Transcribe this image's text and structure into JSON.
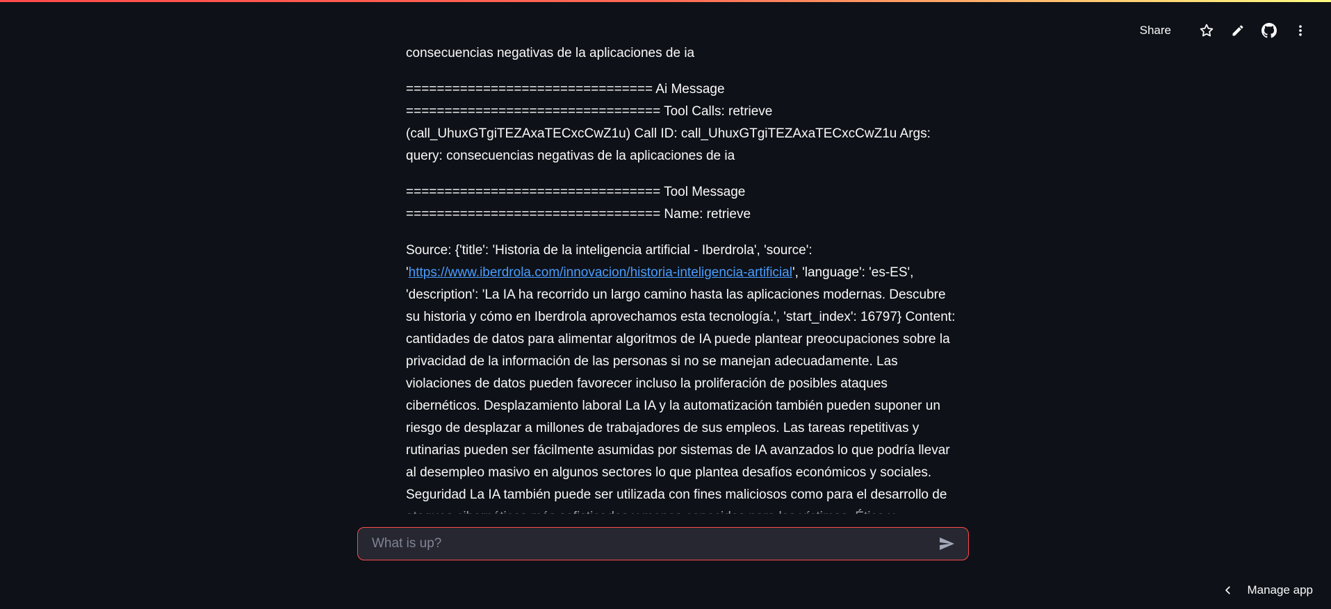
{
  "header": {
    "share_label": "Share",
    "icons": [
      "star-icon",
      "pencil-icon",
      "github-icon",
      "more-vert-icon"
    ]
  },
  "messages": {
    "line_top": "consecuencias negativas de la aplicaciones de ia",
    "ai_message": "================================ Ai Message ================================= Tool Calls: retrieve (call_UhuxGTgiTEZAxaTECxcCwZ1u) Call ID: call_UhuxGTgiTEZAxaTECxcCwZ1u Args: query: consecuencias negativas de la aplicaciones de ia",
    "tool_message": "================================= Tool Message ================================= Name: retrieve",
    "source_before_link": "Source: {'title': 'Historia de la inteligencia artificial - Iberdrola', 'source': '",
    "source_link": "https://www.iberdrola.com/innovacion/historia-inteligencia-artificial",
    "source_after_link": "', 'language': 'es-ES', 'description': 'La IA ha recorrido un largo camino hasta las aplicaciones modernas. Descubre su historia y cómo en Iberdrola aprovechamos esta tecnología.', 'start_index': 16797} Content: cantidades de datos para alimentar algoritmos de IA puede plantear preocupaciones sobre la privacidad de la información de las personas si no se manejan adecuadamente. Las violaciones de datos pueden favorecer incluso la proliferación de posibles ataques cibernéticos. Desplazamiento laboral La IA y la automatización también pueden suponer un riesgo de desplazar a millones de trabajadores de sus empleos. Las tareas repetitivas y rutinarias pueden ser fácilmente asumidas por sistemas de IA avanzados lo que podría llevar al desempleo masivo en algunos sectores lo que plantea desafíos económicos y sociales. Seguridad La IA también puede ser utilizada con fines maliciosos como para el desarrollo de ataques cibernéticos más sofisticados y menos conocidos para las víctimas. Ética y responsabilidad legal Las decisiones"
  },
  "chat_input": {
    "placeholder": "What is up?",
    "value": ""
  },
  "footer": {
    "manage_label": "Manage app"
  },
  "colors": {
    "background": "#0e1117",
    "input_bg": "#262730",
    "accent": "#ff4b4b",
    "link": "#4a9dff"
  }
}
